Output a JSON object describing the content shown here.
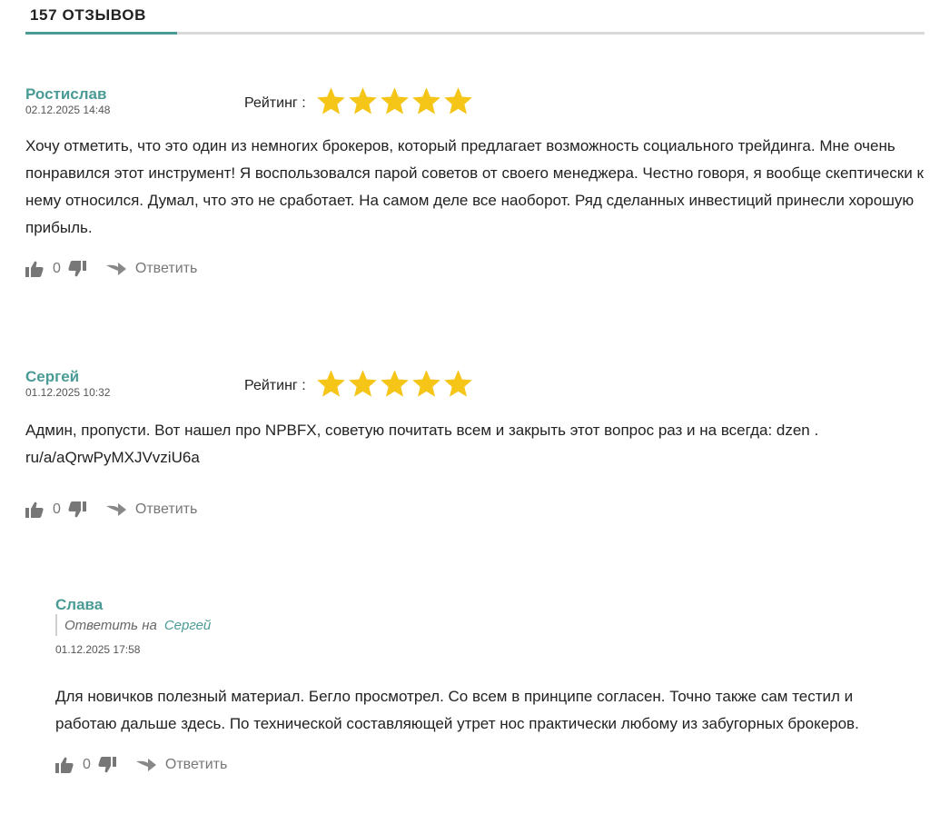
{
  "header": {
    "title": "157 ОТЗЫВОВ"
  },
  "reviews": [
    {
      "author": "Ростислав",
      "date": "02.12.2025 14:48",
      "rating_label": "Рейтинг :",
      "rating": 5,
      "text": "Хочу отметить, что это один из немногих брокеров, который предлагает возможность социального трейдинга. Мне очень понравился этот инструмент! Я воспользовался парой советов от своего менеджера. Честно говоря, я вообще скептически к нему относился. Думал, что это не сработает. На самом деле все наоборот. Ряд сделанных инвестиций принесли хорошую прибыль.",
      "likes": "0",
      "reply_label": "Ответить"
    },
    {
      "author": "Сергей",
      "date": "01.12.2025 10:32",
      "rating_label": "Рейтинг :",
      "rating": 5,
      "text": "Админ, пропусти. Вот нашел про NPBFX, советую почитать всем и закрыть этот вопрос раз и на всегда: dzen . ru/a/aQrwPyMXJVvziU6a",
      "likes": "0",
      "reply_label": "Ответить"
    }
  ],
  "reply": {
    "author": "Слава",
    "reply_to_label": "Ответить на",
    "reply_to_name": "Сергей",
    "date": "01.12.2025 17:58",
    "text": "Для новичков полезный материал. Бегло просмотрел. Со всем в принципе согласен. Точно также сам тестил и работаю дальше здесь. По технической составляющей утрет нос практически любому из забугорных брокеров.",
    "likes": "0",
    "reply_label": "Ответить"
  },
  "colors": {
    "accent": "#4a9b95",
    "star": "#f5c518",
    "divider": "#d9d9d9"
  },
  "icons": [
    "thumbs-up-icon",
    "thumbs-down-icon",
    "reply-arrow-icon",
    "star-icon"
  ]
}
